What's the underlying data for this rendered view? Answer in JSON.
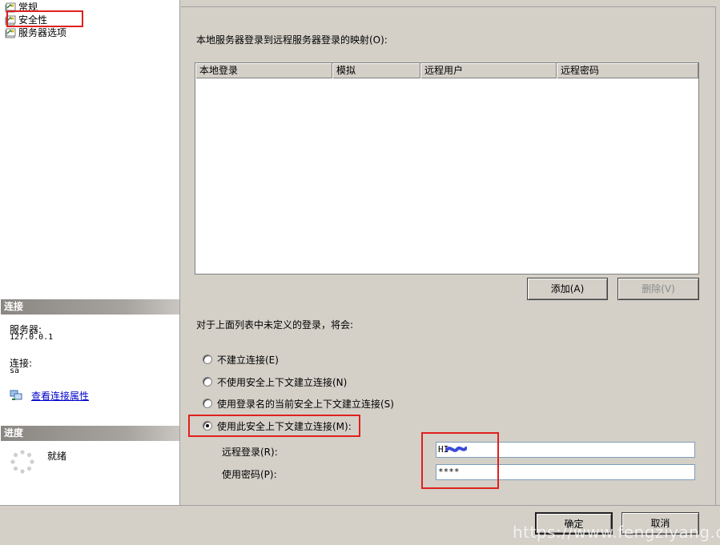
{
  "nav": {
    "items": [
      {
        "label": "常规"
      },
      {
        "label": "安全性"
      },
      {
        "label": "服务器选项"
      }
    ]
  },
  "connection": {
    "header": "连接",
    "server_label": "服务器:",
    "server_value": "127.0.0.1",
    "login_label": "连接:",
    "login_value": "sa",
    "view_props_link": "查看连接属性"
  },
  "progress": {
    "header": "进度",
    "status": "就绪"
  },
  "main": {
    "mapping_title": "本地服务器登录到远程服务器登录的映射(O):",
    "columns": [
      "本地登录",
      "模拟",
      "远程用户",
      "远程密码"
    ],
    "rows": [],
    "add_button": "添加(A)",
    "remove_button": "删除(V)",
    "undefined_title": "对于上面列表中未定义的登录，将会:",
    "options": [
      {
        "label": "不建立连接(E)",
        "checked": false
      },
      {
        "label": "不使用安全上下文建立连接(N)",
        "checked": false
      },
      {
        "label": "使用登录名的当前安全上下文建立连接(S)",
        "checked": false
      },
      {
        "label": "使用此安全上下文建立连接(M):",
        "checked": true
      }
    ],
    "remote_login_label": "远程登录(R):",
    "remote_login_value": "HI",
    "password_label": "使用密码(P):",
    "password_value": "****"
  },
  "footer": {
    "ok_button": "确定",
    "cancel_button": "取消"
  },
  "watermark": "https://www.fengziyang.cn",
  "colors": {
    "annotation_red": "#e0201c",
    "link_blue": "#0000cc",
    "window_gray": "#d4d0c8"
  },
  "icons": {
    "page": "page-icon",
    "link": "network-connection-icon",
    "progress": "spinner-icon"
  }
}
